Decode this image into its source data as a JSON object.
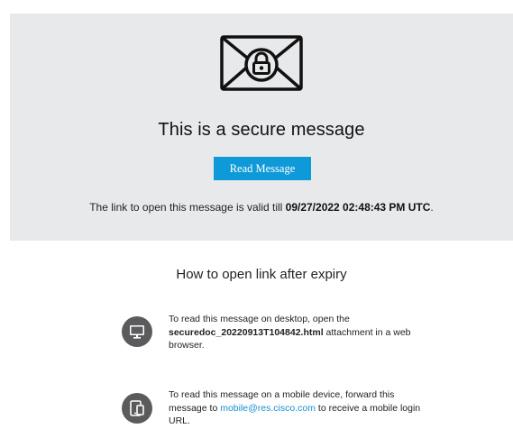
{
  "hero": {
    "title": "This is a secure message",
    "read_button_label": "Read Message",
    "validity_prefix": "The link to open this message is valid till ",
    "validity_datetime": "09/27/2022 02:48:43 PM UTC",
    "validity_suffix": "."
  },
  "expiry": {
    "heading": "How to open link after expiry",
    "desktop": {
      "icon": "desktop-monitor-icon",
      "text_prefix": "To read this message on desktop, open the ",
      "attachment_name": "securedoc_20220913T104842.html",
      "text_suffix": " attachment in a web browser."
    },
    "mobile": {
      "icon": "mobile-device-icon",
      "text_prefix": "To read this message on a mobile device, forward this message to ",
      "email": "mobile@res.cisco.com",
      "text_suffix": " to receive a mobile login URL."
    }
  },
  "colors": {
    "hero_background": "#e8e9eb",
    "button": "#0e9ad8",
    "icon_circle": "#5b5b5d",
    "link": "#1a8fd6"
  }
}
